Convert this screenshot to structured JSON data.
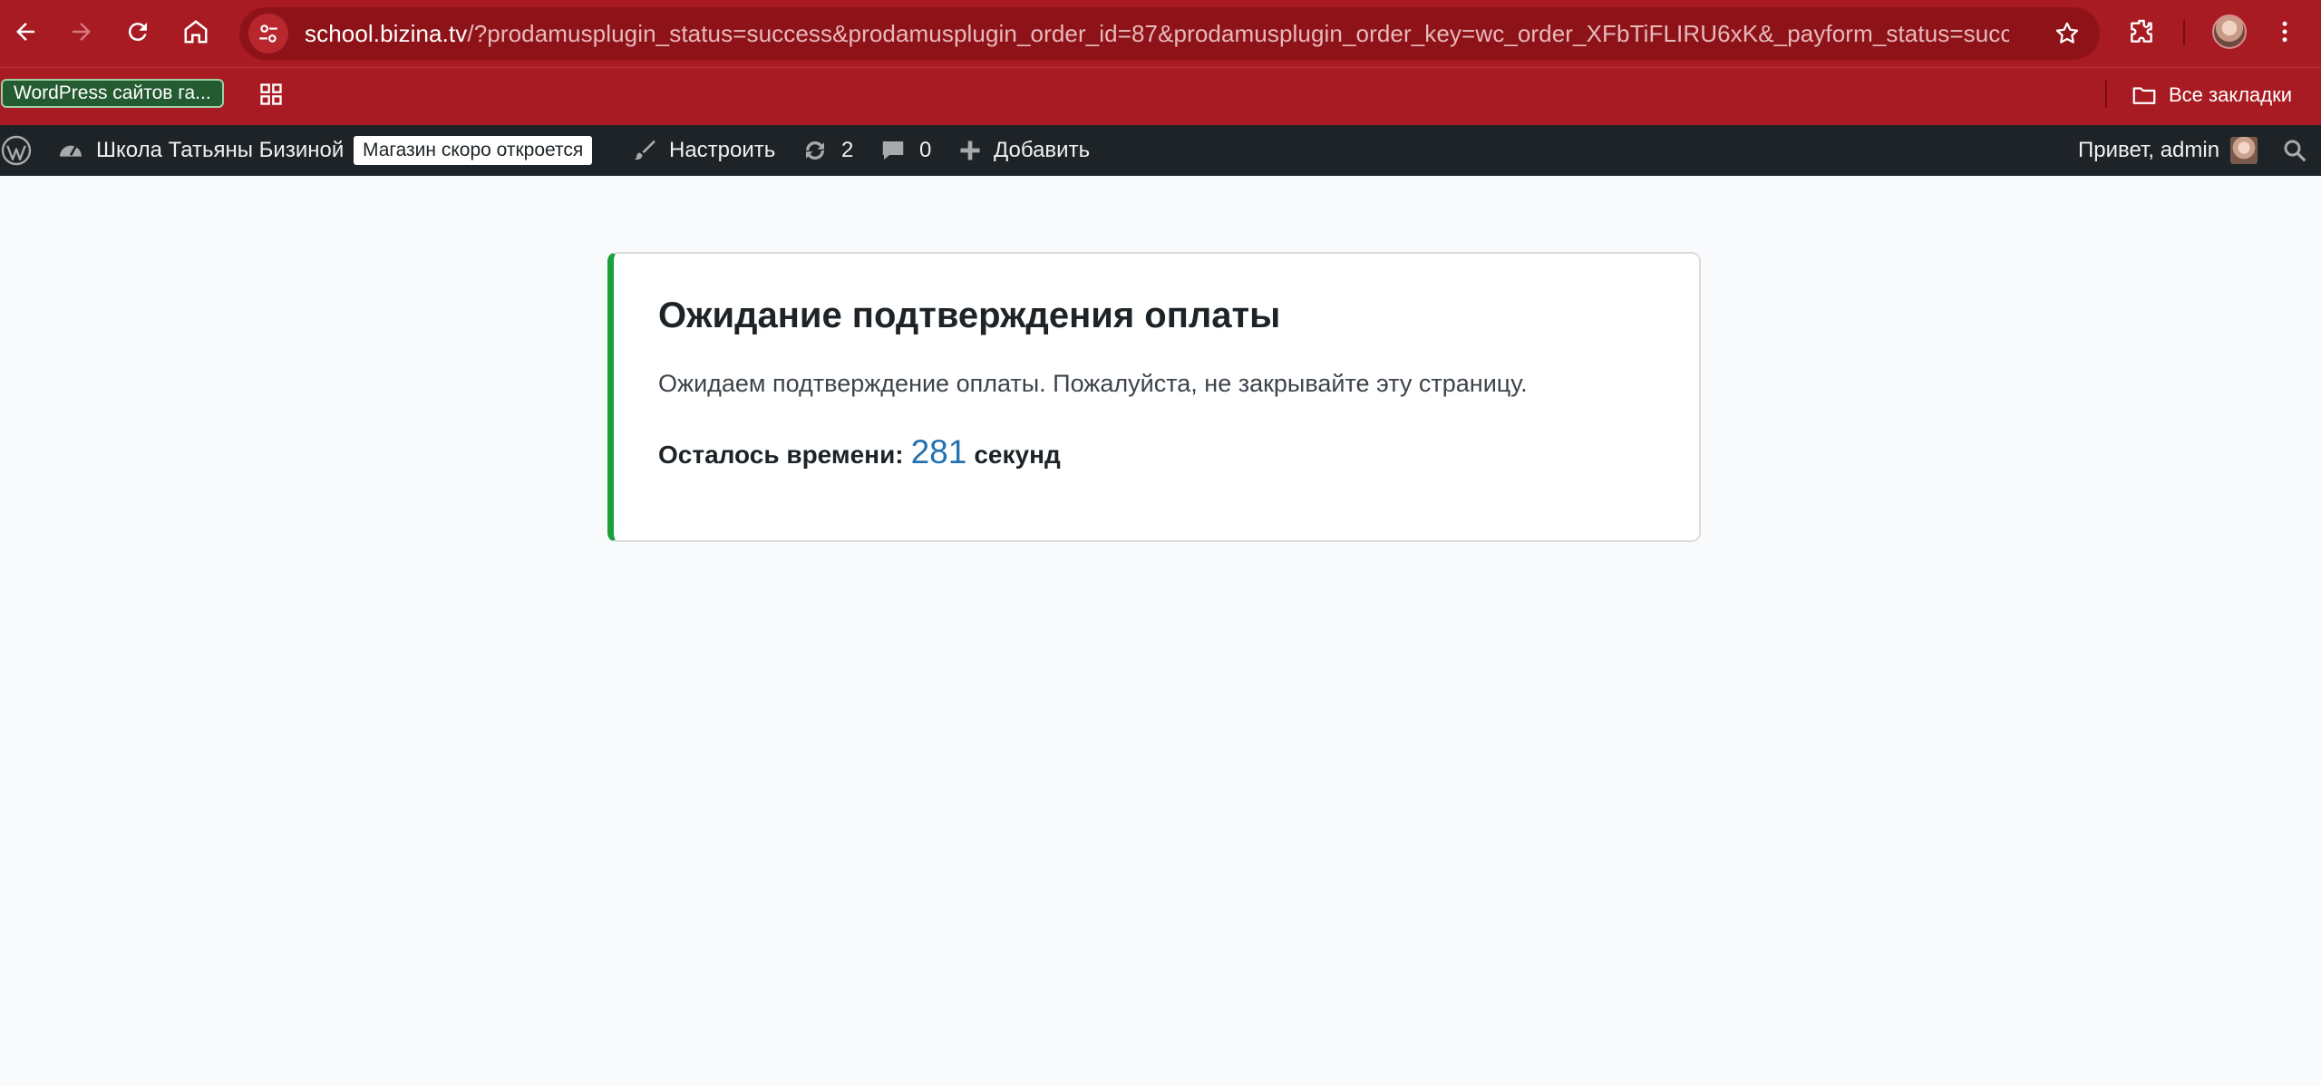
{
  "browser": {
    "url_host": "school.bizina.tv",
    "url_rest": "/?prodamusplugin_status=success&prodamusplugin_order_id=87&prodamusplugin_order_key=wc_order_XFbTiFLIRU6xK&_payform_status=succe...",
    "bookmark_chip": "WordPress сайтов га...",
    "all_bookmarks": "Все закладки"
  },
  "adminbar": {
    "site_name": "Школа Татьяны Бизиной",
    "store_badge": "Магазин скоро откроется",
    "customize": "Настроить",
    "updates_count": "2",
    "comments_count": "0",
    "add_new": "Добавить",
    "greeting": "Привет, admin"
  },
  "notice": {
    "title": "Ожидание подтверждения оплаты",
    "text": "Ожидаем подтверждение оплаты. Пожалуйста, не закрывайте эту страницу.",
    "timer_label": "Осталось времени:",
    "timer_value": "281",
    "timer_unit": "секунд"
  },
  "colors": {
    "chrome": "#a81b22",
    "adminbar": "#1d2327",
    "accent_border": "#1aa13a",
    "timer": "#2271b1"
  }
}
